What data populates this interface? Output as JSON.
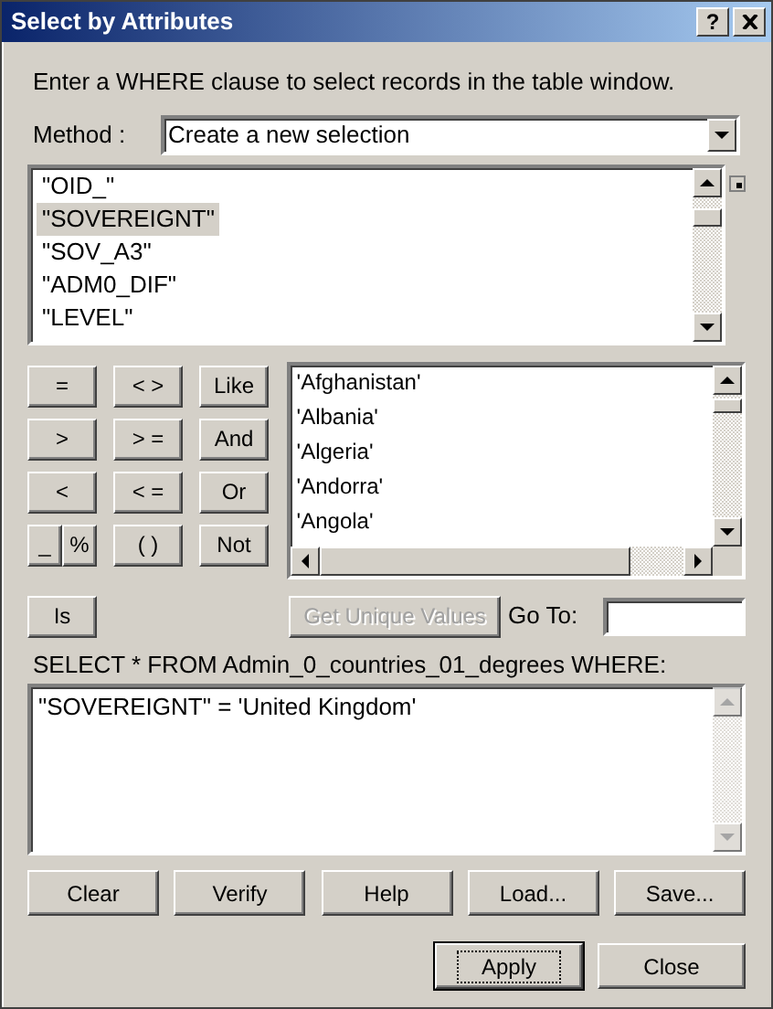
{
  "window": {
    "title": "Select by Attributes",
    "help_button": "?"
  },
  "prompt": "Enter a WHERE clause to select records in the table window.",
  "method": {
    "label": "Method :",
    "value": "Create a new selection"
  },
  "fields": [
    {
      "name": "\"OID_\"",
      "selected": false
    },
    {
      "name": "\"SOVEREIGNT\"",
      "selected": true
    },
    {
      "name": "\"SOV_A3\"",
      "selected": false
    },
    {
      "name": "\"ADM0_DIF\"",
      "selected": false
    },
    {
      "name": "\"LEVEL\"",
      "selected": false
    }
  ],
  "operators": [
    {
      "kind": "single",
      "label": "="
    },
    {
      "kind": "single",
      "label": "< >"
    },
    {
      "kind": "single",
      "label": "Like"
    },
    {
      "kind": "single",
      "label": ">"
    },
    {
      "kind": "single",
      "label": "> ="
    },
    {
      "kind": "single",
      "label": "And"
    },
    {
      "kind": "single",
      "label": "<"
    },
    {
      "kind": "single",
      "label": "< ="
    },
    {
      "kind": "single",
      "label": "Or"
    },
    {
      "kind": "split",
      "labels": [
        "_",
        "%"
      ]
    },
    {
      "kind": "single",
      "label": "( )"
    },
    {
      "kind": "single",
      "label": "Not"
    },
    {
      "kind": "single",
      "label": "Is"
    }
  ],
  "values": [
    "'Afghanistan'",
    "'Albania'",
    "'Algeria'",
    "'Andorra'",
    "'Angola'"
  ],
  "get_unique_values": {
    "label": "Get Unique Values",
    "disabled": true
  },
  "go_to": {
    "label": "Go To:"
  },
  "query_label": "SELECT * FROM Admin_0_countries_01_degrees WHERE:",
  "query": "\"SOVEREIGNT\" = 'United Kingdom'",
  "action_buttons": [
    {
      "label": "Clear"
    },
    {
      "label": "Verify"
    },
    {
      "label": "Help"
    },
    {
      "label": "Load..."
    },
    {
      "label": "Save..."
    }
  ],
  "dialog_buttons": [
    {
      "label": "Apply",
      "focused": true
    },
    {
      "label": "Close",
      "focused": false
    }
  ]
}
